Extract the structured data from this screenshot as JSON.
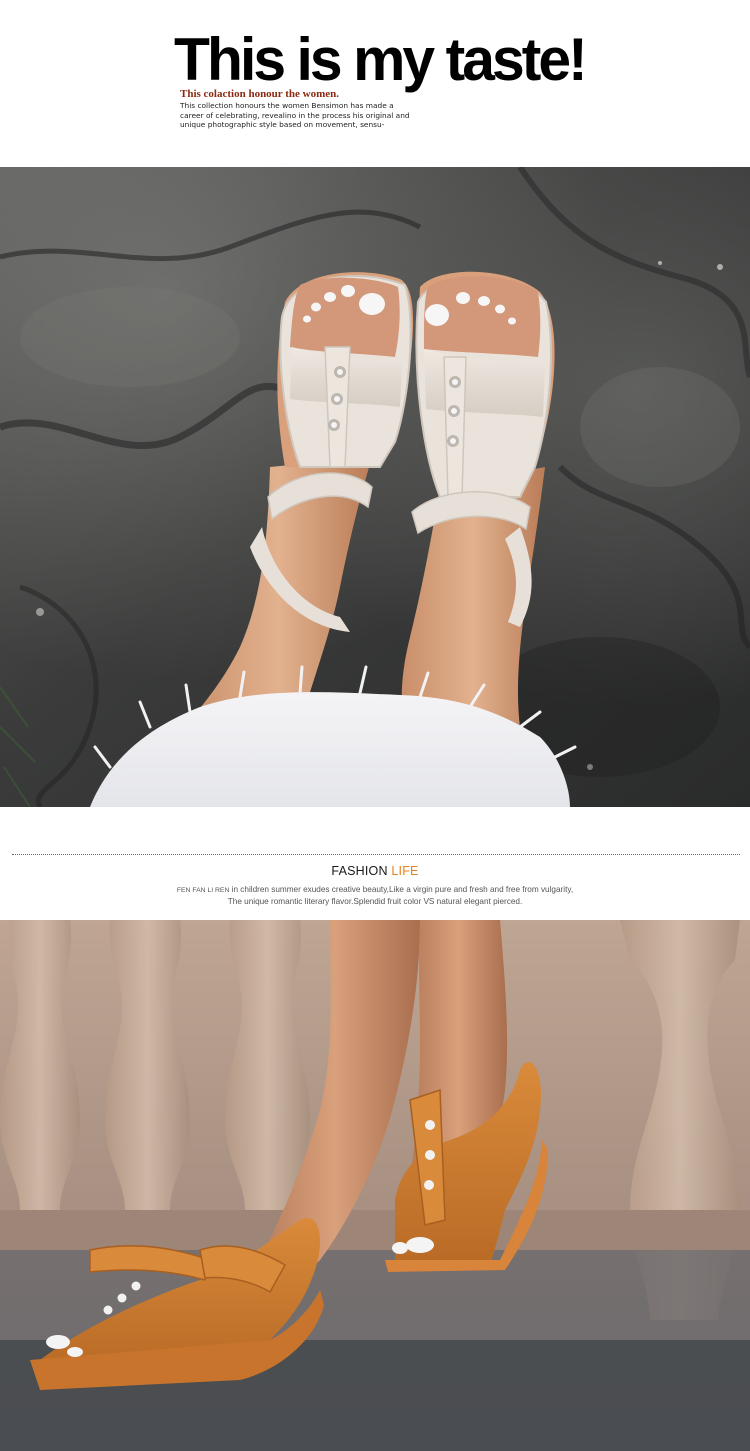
{
  "header": {
    "headline": "This is my taste!",
    "subhead": "This colaction honour the women.",
    "blurb": "This collection honours the women Bensimon has made a career of celebrating, revealino in the process his original and unique photographic style based on movement, sensu-"
  },
  "fashion_band": {
    "title_main": "FASHION ",
    "title_accent": "LIFE",
    "brand": "FEN FAN LI REN",
    "line1": " in children summer exudes creative beauty,Like a virgin pure and fresh and free from vulgarity,",
    "line2": "The unique romantic literary flavor.Splendid fruit color VS natural elegant pierced."
  },
  "colors": {
    "accent_orange": "#e8811c",
    "subhead_red": "#8a2a12",
    "beige_sandal": "#e4ddd5",
    "tan_sandal": "#c87a2f"
  }
}
